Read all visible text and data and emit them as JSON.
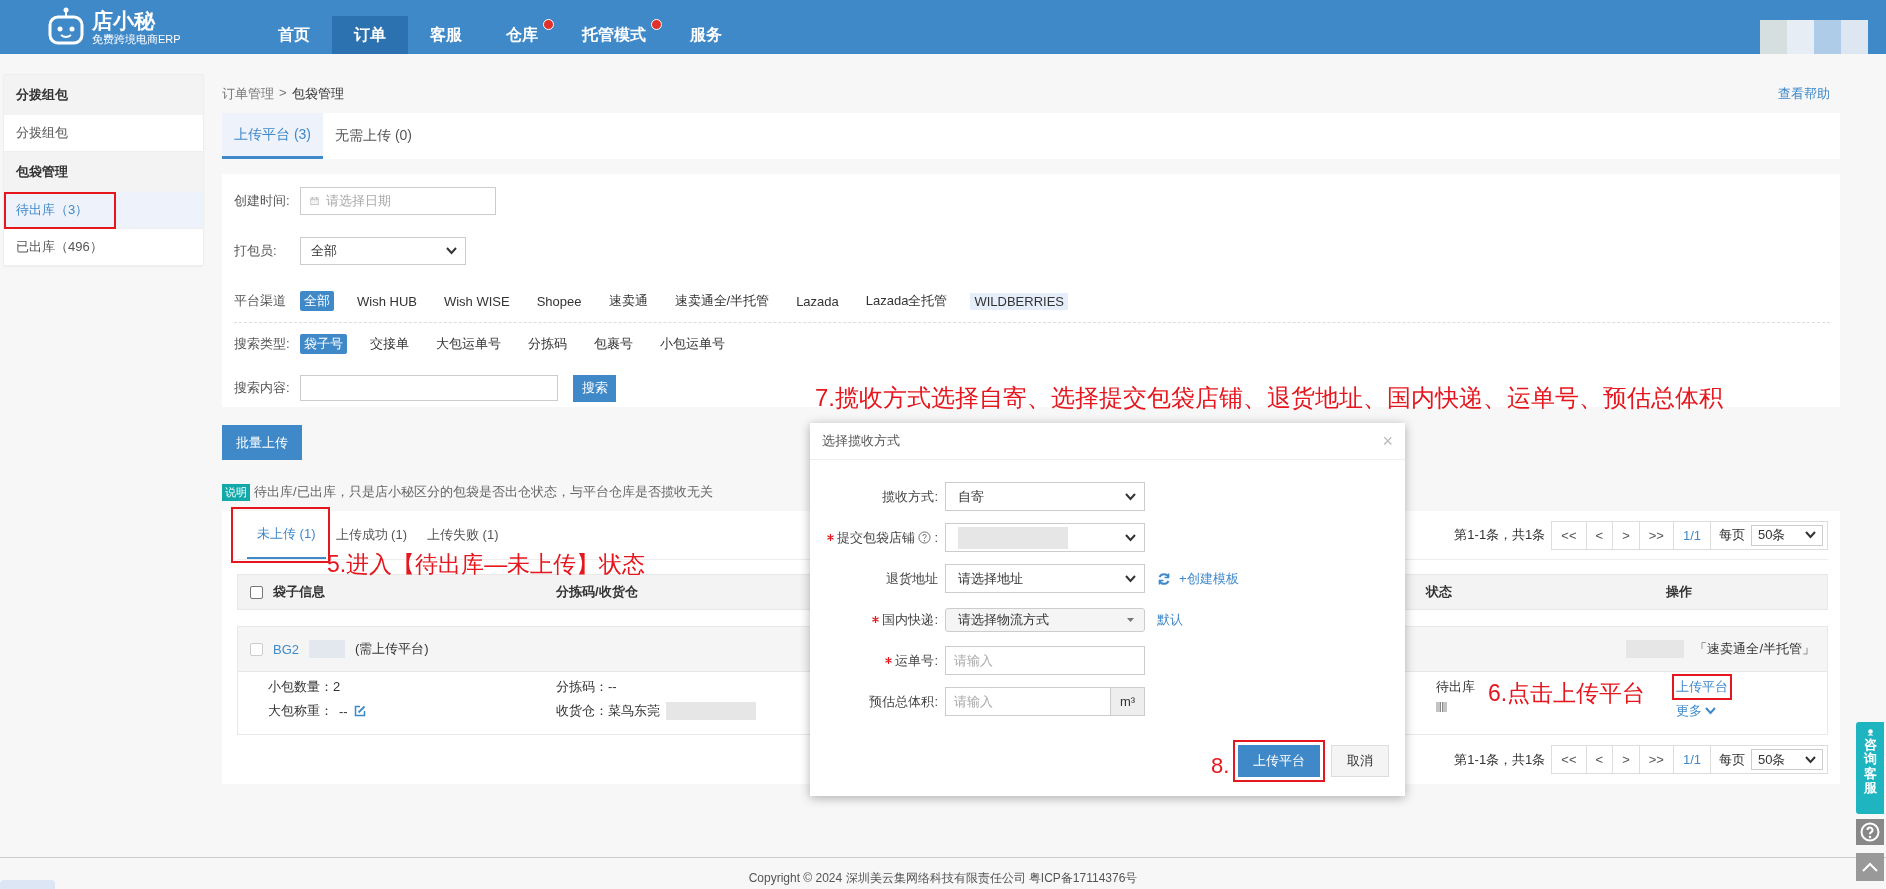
{
  "header": {
    "logo": {
      "name": "店小秘",
      "tagline": "免费跨境电商ERP"
    },
    "nav": [
      {
        "label": "首页",
        "selected": false,
        "dot": false
      },
      {
        "label": "订单",
        "selected": true,
        "dot": false
      },
      {
        "label": "客服",
        "selected": false,
        "dot": false
      },
      {
        "label": "仓库",
        "selected": false,
        "dot": true
      },
      {
        "label": "托管模式",
        "selected": false,
        "dot": true
      },
      {
        "label": "服务",
        "selected": false,
        "dot": false
      }
    ]
  },
  "sidebar": [
    {
      "title": "分拨组包",
      "items": [
        {
          "label": "分拨组包",
          "selected": false
        }
      ]
    },
    {
      "title": "包袋管理",
      "items": [
        {
          "label": "待出库（3）",
          "selected": true
        },
        {
          "label": "已出库（496）",
          "selected": false
        }
      ]
    }
  ],
  "breadcrumb": {
    "items": [
      "订单管理",
      "包袋管理"
    ],
    "separator": ">"
  },
  "help_link": "查看帮助",
  "main_tabs": [
    {
      "label": "上传平台 (3)",
      "selected": true
    },
    {
      "label": "无需上传 (0)",
      "selected": false
    }
  ],
  "filters": {
    "created_time": {
      "label": "创建时间:",
      "placeholder": "请选择日期"
    },
    "packer": {
      "label": "打包员:",
      "value": "全部"
    },
    "platform": {
      "label": "平台渠道",
      "options": [
        {
          "label": "全部",
          "selected": true,
          "hovered": false
        },
        {
          "label": "Wish HUB",
          "selected": false,
          "hovered": false
        },
        {
          "label": "Wish WISE",
          "selected": false,
          "hovered": false
        },
        {
          "label": "Shopee",
          "selected": false,
          "hovered": false
        },
        {
          "label": "速卖通",
          "selected": false,
          "hovered": false
        },
        {
          "label": "速卖通全/半托管",
          "selected": false,
          "hovered": false
        },
        {
          "label": "Lazada",
          "selected": false,
          "hovered": false
        },
        {
          "label": "Lazada全托管",
          "selected": false,
          "hovered": false
        },
        {
          "label": "WILDBERRIES",
          "selected": false,
          "hovered": true
        }
      ]
    },
    "search_type": {
      "label": "搜索类型:",
      "options": [
        {
          "label": "袋子号",
          "selected": true,
          "hovered": false
        },
        {
          "label": "交接单",
          "selected": false,
          "hovered": false
        },
        {
          "label": "大包运单号",
          "selected": false,
          "hovered": false
        },
        {
          "label": "分拣码",
          "selected": false,
          "hovered": false
        },
        {
          "label": "包裹号",
          "selected": false,
          "hovered": false
        },
        {
          "label": "小包运单号",
          "selected": false,
          "hovered": false
        }
      ]
    },
    "search_content": {
      "label": "搜索内容:",
      "button": "搜索"
    }
  },
  "bulk_upload_button": "批量上传",
  "notice": {
    "badge": "说明",
    "text": "待出库/已出库，只是店小秘区分的包袋是否出仓状态，与平台仓库是否揽收无关"
  },
  "sub_tabs": [
    {
      "label": "未上传 (1)",
      "selected": true
    },
    {
      "label": "上传成功 (1)",
      "selected": false
    },
    {
      "label": "上传失败 (1)",
      "selected": false
    }
  ],
  "pagination_top": {
    "summary": "第1-1条，共1条",
    "buttons": [
      "<<",
      "<",
      ">",
      ">>"
    ],
    "page": "1/1",
    "per_page_label": "每页",
    "per_page": "50条"
  },
  "table": {
    "columns": [
      "袋子信息",
      "分拣码/收货仓",
      "状态",
      "操作"
    ],
    "all_checked": false,
    "rows": [
      {
        "checked": false,
        "bag_no": "BG2",
        "note": "(需上传平台)",
        "tag": "「速卖通全/半托管」",
        "small_count": "小包数量：2",
        "weight_label": "大包称重：",
        "weight": "--",
        "sort_code": "分拣码：--",
        "warehouse": "收货仓：菜鸟东莞",
        "status": "待出库",
        "actions": {
          "primary": "上传平台",
          "more": "更多"
        }
      }
    ]
  },
  "pagination_bottom": {
    "summary": "第1-1条，共1条",
    "buttons": [
      "<<",
      "<",
      ">",
      ">>"
    ],
    "page": "1/1",
    "per_page_label": "每页",
    "per_page": "50条"
  },
  "modal": {
    "title": "选择揽收方式",
    "close": "×",
    "fields": [
      {
        "kind": "select",
        "label": "揽收方式:",
        "required": false,
        "value": "自寄"
      },
      {
        "kind": "redacted_select",
        "label": "提交包袋店铺",
        "colon": ":",
        "required": true
      },
      {
        "kind": "select",
        "label": "退货地址",
        "required": false,
        "value": "请选择地址",
        "link": "+创建模板"
      },
      {
        "kind": "dropdown",
        "label": "国内快递:",
        "required": true,
        "value": "请选择物流方式",
        "link": "默认"
      },
      {
        "kind": "input",
        "label": "运单号:",
        "required": true,
        "placeholder": "请输入"
      },
      {
        "kind": "unit_input",
        "label": "预估总体积:",
        "required": false,
        "placeholder": "请输入",
        "unit": "m³"
      }
    ],
    "buttons": [
      {
        "label": "上传平台",
        "primary": true
      },
      {
        "label": "取消",
        "primary": false
      }
    ]
  },
  "support": "咨询客服",
  "footer": "Copyright © 2024 深圳美云集网络科技有限责任公司 粤ICP备17114376号",
  "annotations": [
    {
      "text": "7.揽收方式选择自寄、选择提交包袋店铺、退货地址、国内快递、运单号、预估总体积"
    },
    {
      "text": "5.进入【待出库—未上传】状态"
    },
    {
      "text": "6.点击上传平台"
    },
    {
      "text": "8."
    }
  ]
}
